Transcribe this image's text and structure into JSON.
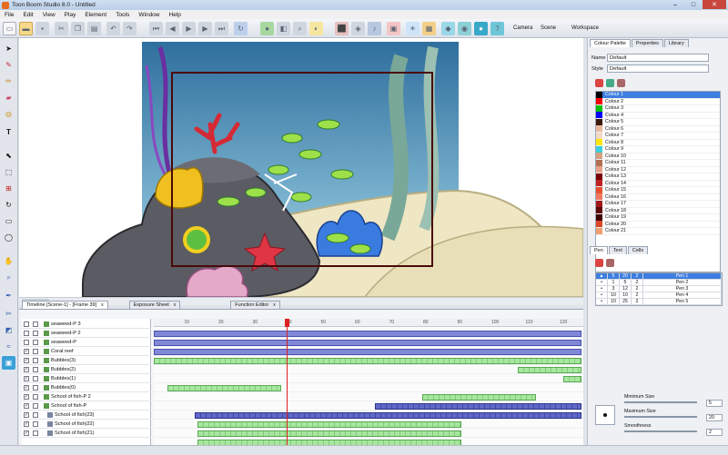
{
  "window": {
    "title": "Toon Boom Studio 8.0 - Untitled",
    "minimize": "–",
    "maximize": "□",
    "close": "✕"
  },
  "menu": [
    "File",
    "Edit",
    "View",
    "Play",
    "Element",
    "Tools",
    "Window",
    "Help"
  ],
  "toolbar": {
    "camera_label": "Camera",
    "scene_label": "Scene",
    "workspace_label": "Workspace"
  },
  "timeline": {
    "tabs": [
      {
        "label": "Timeline [Scene-1] - [Frame 39]"
      },
      {
        "label": "Exposure Sheet"
      },
      {
        "label": "Function Editor"
      }
    ],
    "tab_close": "x",
    "frame_numbers": [
      "10",
      "20",
      "30",
      "40",
      "50",
      "60",
      "70",
      "80",
      "90",
      "100",
      "110",
      "120"
    ],
    "current_frame": 39,
    "layers": [
      {
        "name": "seaweed-P 3",
        "indent": 1,
        "checked": false
      },
      {
        "name": "seaweed-P 2",
        "indent": 1,
        "checked": false
      },
      {
        "name": "seaweed-P",
        "indent": 1,
        "checked": false
      },
      {
        "name": "Coral reef",
        "indent": 1,
        "checked": true
      },
      {
        "name": "Bubbles(3)",
        "indent": 1,
        "checked": true
      },
      {
        "name": "Bubbles(2)",
        "indent": 1,
        "checked": true
      },
      {
        "name": "Bubbles(1)",
        "indent": 1,
        "checked": true
      },
      {
        "name": "Bubbles(0)",
        "indent": 1,
        "checked": true
      },
      {
        "name": "School of fish-P 2",
        "indent": 1,
        "checked": true
      },
      {
        "name": "School of fish-P",
        "indent": 1,
        "checked": true
      },
      {
        "name": "School of fish(23)",
        "indent": 2,
        "checked": true
      },
      {
        "name": "School of fish(22)",
        "indent": 2,
        "checked": true
      },
      {
        "name": "School of fish(21)",
        "indent": 2,
        "checked": true
      }
    ]
  },
  "colour_palette": {
    "tabs": [
      {
        "label": "Colour Palette"
      },
      {
        "label": "Properties"
      },
      {
        "label": "Library"
      }
    ],
    "name_label": "Name",
    "name_value": "Default",
    "style_label": "Style",
    "style_value": "Default",
    "colours": [
      {
        "name": "Colour 1",
        "hex": "#000000"
      },
      {
        "name": "Colour 2",
        "hex": "#ff0000"
      },
      {
        "name": "Colour 3",
        "hex": "#00c000"
      },
      {
        "name": "Colour 4",
        "hex": "#0000ff"
      },
      {
        "name": "Colour 5",
        "hex": "#3a1a0a"
      },
      {
        "name": "Colour 6",
        "hex": "#e8b89a"
      },
      {
        "name": "Colour 7",
        "hex": "#f4d9c4"
      },
      {
        "name": "Colour 8",
        "hex": "#ffe600"
      },
      {
        "name": "Colour 9",
        "hex": "#3ad0e0"
      },
      {
        "name": "Colour 10",
        "hex": "#d6a080"
      },
      {
        "name": "Colour 11",
        "hex": "#b07050"
      },
      {
        "name": "Colour 12",
        "hex": "#e8a088"
      },
      {
        "name": "Colour 13",
        "hex": "#7a0000"
      },
      {
        "name": "Colour 14",
        "hex": "#c02020"
      },
      {
        "name": "Colour 15",
        "hex": "#e85030"
      },
      {
        "name": "Colour 16",
        "hex": "#f07860"
      },
      {
        "name": "Colour 17",
        "hex": "#a01818"
      },
      {
        "name": "Colour 18",
        "hex": "#600808"
      },
      {
        "name": "Colour 19",
        "hex": "#400000"
      },
      {
        "name": "Colour 20",
        "hex": "#d84828"
      },
      {
        "name": "Colour 21",
        "hex": "#f0a070"
      }
    ]
  },
  "pen_panel": {
    "tabs": [
      {
        "label": "Pen"
      },
      {
        "label": "Text"
      },
      {
        "label": "Cells"
      }
    ],
    "pens": [
      {
        "c0": "▲",
        "c1": "5",
        "c2": "20",
        "c3": "2",
        "name": "Pen 1"
      },
      {
        "c0": "•",
        "c1": "1",
        "c2": "5",
        "c3": "2",
        "name": "Pen 2"
      },
      {
        "c0": "•",
        "c1": "3",
        "c2": "12",
        "c3": "2",
        "name": "Pen 3"
      },
      {
        "c0": "•",
        "c1": "10",
        "c2": "10",
        "c3": "2",
        "name": "Pen 4"
      },
      {
        "c0": "•",
        "c1": "10",
        "c2": "25",
        "c3": "2",
        "name": "Pen 5"
      }
    ],
    "minimum_size_label": "Minimum Size",
    "minimum_size": "5",
    "maximum_size_label": "Maximum Size",
    "maximum_size": "20",
    "smoothness_label": "Smoothness",
    "smoothness": "2"
  },
  "colors": {
    "accent": "#3d7ee0",
    "playhead": "#e02020",
    "stage_water": "#4aa0c8",
    "sand": "#efe6c4"
  },
  "icons": {
    "file": "document-icon",
    "open": "folder-icon",
    "save": "save-icon",
    "play": "play-icon",
    "rewind": "rewind-icon",
    "select": "arrow-icon",
    "brush": "brush-icon",
    "pencil": "pencil-icon",
    "eraser": "eraser-icon",
    "zoom": "magnifier-icon",
    "text": "text-icon"
  }
}
